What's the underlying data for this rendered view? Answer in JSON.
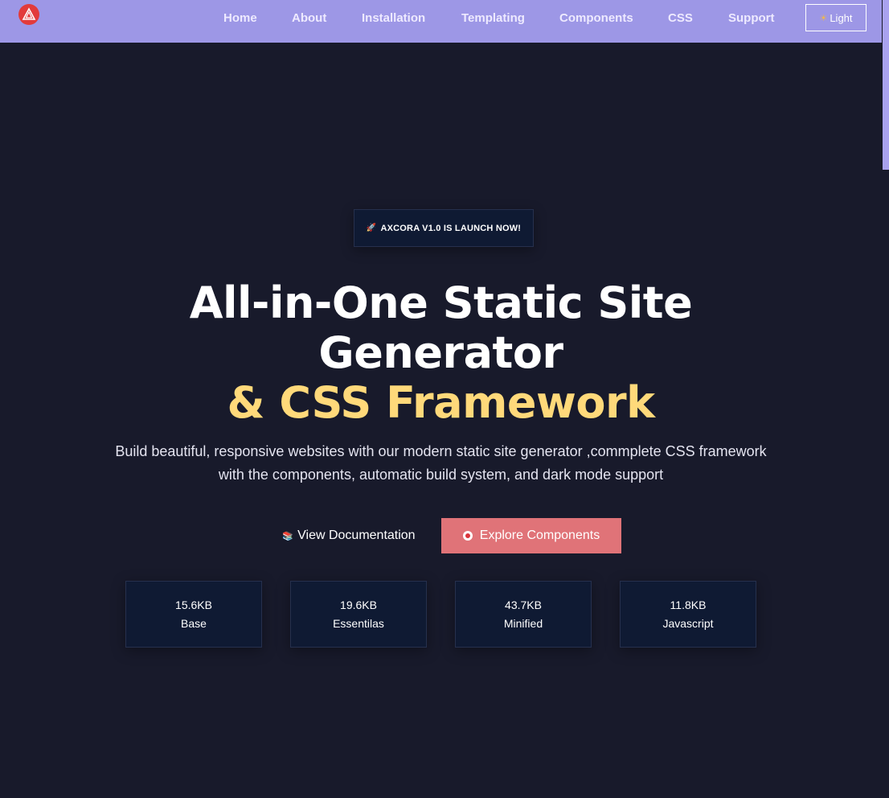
{
  "nav": {
    "logo_icon": "axcora-logo-icon",
    "links": [
      "Home",
      "About",
      "Installation",
      "Templating",
      "Components",
      "CSS",
      "Support"
    ],
    "theme_toggle": {
      "icon": "sun-icon",
      "label": "Light"
    }
  },
  "hero": {
    "badge": {
      "icon": "rocket-icon",
      "text": "AXCORA V1.0 IS LAUNCH NOW!"
    },
    "title_line1": "All-in-One Static Site",
    "title_line2": "Generator",
    "title_line3": "& CSS Framework",
    "subtitle": "Build beautiful, responsive websites with our modern static site generator ,commplete CSS framework with the components, automatic build system, and dark mode support",
    "primary_button": {
      "icon": "books-icon",
      "label": "View Documentation"
    },
    "secondary_button": {
      "icon": "shield-icon",
      "label": "Explore Components"
    }
  },
  "stats": [
    {
      "size": "15.6KB",
      "label": "Base"
    },
    {
      "size": "19.6KB",
      "label": "Essentilas"
    },
    {
      "size": "43.7KB",
      "label": "Minified"
    },
    {
      "size": "11.8KB",
      "label": "Javascript"
    }
  ],
  "colors": {
    "nav_bg": "#9d97e6",
    "page_bg": "#181a2b",
    "card_bg": "#0f1a33",
    "accent_yellow": "#ffd97a",
    "accent_red": "#e07378"
  }
}
